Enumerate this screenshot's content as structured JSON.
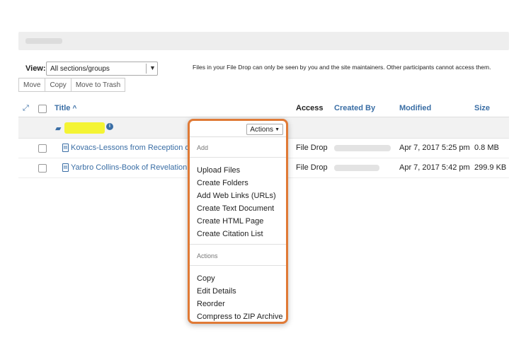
{
  "toolbar": {
    "view_label": "View:",
    "view_value": "All sections/groups",
    "notice": "Files in your File Drop can only be seen by you and the site maintainers. Other participants cannot access them.",
    "buttons": [
      "Move",
      "Copy",
      "Move to Trash"
    ]
  },
  "columns": {
    "title": "Title",
    "access": "Access",
    "created_by": "Created By",
    "modified": "Modified",
    "size": "Size"
  },
  "files": [
    {
      "name": "Kovacs-Lessons from Reception of",
      "access": "File Drop",
      "modified": "Apr 7, 2017 5:25 pm",
      "size": "0.8 MB"
    },
    {
      "name": "Yarbro Collins-Book of Revelation.p",
      "access": "File Drop",
      "modified": "Apr 7, 2017 5:42 pm",
      "size": "299.9 KB"
    }
  ],
  "menu": {
    "button_label": "Actions",
    "add_header": "Add",
    "add_items": [
      "Upload Files",
      "Create Folders",
      "Add Web Links (URLs)",
      "Create Text Document",
      "Create HTML Page",
      "Create Citation List"
    ],
    "actions_header": "Actions",
    "action_items": [
      "Copy",
      "Edit Details",
      "Reorder",
      "Compress to ZIP Archive"
    ]
  },
  "colors": {
    "link": "#3a6ea5",
    "highlight": "#f4f434",
    "menu_border": "#e07a36"
  }
}
